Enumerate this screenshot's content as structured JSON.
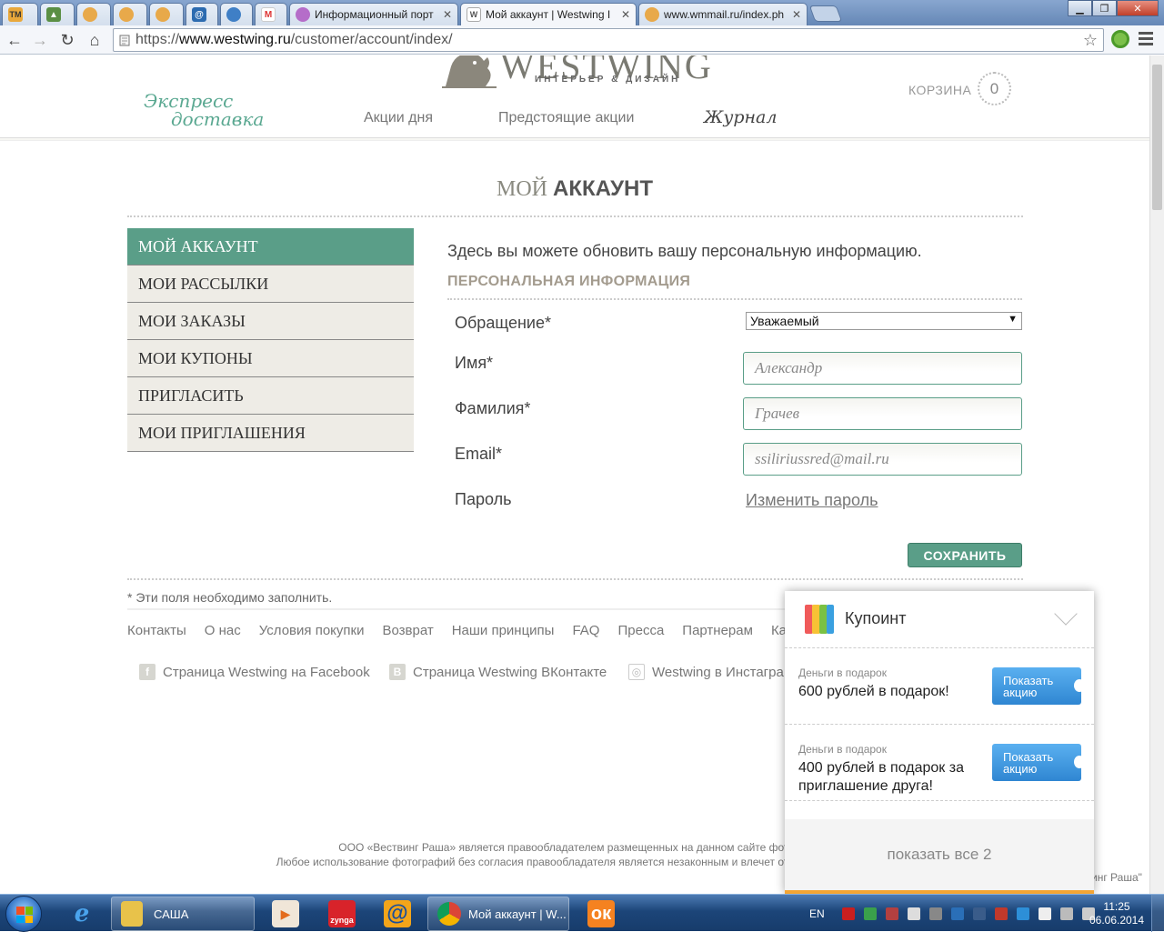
{
  "browser": {
    "tabs": [
      {
        "label": "",
        "icon": "tm-favicon"
      },
      {
        "label": "",
        "icon": "image-favicon"
      },
      {
        "label": "",
        "icon": "webmoney-favicon"
      },
      {
        "label": "",
        "icon": "webmoney-favicon"
      },
      {
        "label": "",
        "icon": "webmoney-favicon"
      },
      {
        "label": "",
        "icon": "mail-at-favicon"
      },
      {
        "label": "",
        "icon": "globe-favicon"
      },
      {
        "label": "",
        "icon": "gmail-favicon"
      },
      {
        "label": "Информационный порт",
        "icon": "portal-favicon"
      },
      {
        "label": "Мой аккаунт | Westwing I",
        "icon": "westwing-favicon"
      },
      {
        "label": "www.wmmail.ru/index.ph",
        "icon": "webmoney-favicon"
      }
    ],
    "url_prefix": "https://",
    "url_host": "www.westwing.ru",
    "url_path": "/customer/account/index/"
  },
  "header": {
    "logo_word": "WESTWING",
    "logo_sub": "ИНТЕРЬЕР & ДИЗАЙН",
    "express_line1": "Экспресс",
    "express_line2": "доставка",
    "nav": [
      "Акции дня",
      "Предстоящие акции"
    ],
    "journal": "Журнал",
    "cart_label": "КОРЗИНА",
    "cart_count": "0"
  },
  "page": {
    "title_light": "МОЙ",
    "title_bold": "АККАУНТ"
  },
  "sidebar": {
    "items": [
      {
        "label": "МОЙ АККАУНТ",
        "active": true
      },
      {
        "label": "МОИ РАССЫЛКИ",
        "active": false
      },
      {
        "label": "МОИ ЗАКАЗЫ",
        "active": false
      },
      {
        "label": "МОИ КУПОНЫ",
        "active": false
      },
      {
        "label": "ПРИГЛАСИТЬ",
        "active": false
      },
      {
        "label": "МОИ ПРИГЛАШЕНИЯ",
        "active": false
      }
    ]
  },
  "form": {
    "intro": "Здесь вы можете обновить вашу персональную информацию.",
    "section": "ПЕРСОНАЛЬНАЯ ИНФОРМАЦИЯ",
    "salutation_label": "Обращение*",
    "salutation_value": "Уважаемый",
    "first_name_label": "Имя*",
    "first_name_value": "Александр",
    "last_name_label": "Фамилия*",
    "last_name_value": "Грачев",
    "email_label": "Email*",
    "email_value": "ssiliriussred@mail.ru",
    "password_label": "Пароль",
    "change_password": "Изменить пароль",
    "save": "СОХРАНИТЬ",
    "required_note": "* Эти поля необходимо заполнить."
  },
  "footer": {
    "links": [
      "Контакты",
      "О нас",
      "Условия покупки",
      "Возврат",
      "Наши принципы",
      "FAQ",
      "Пресса",
      "Партнерам",
      "Ка"
    ],
    "facebook": "Страница Westwing на Facebook",
    "vk": "Страница Westwing ВКонтакте",
    "instagram": "Westwing в Инстагра",
    "copyright_line1": "ООО «Вествинг Раша» является правообладателем размещенных на данном сайте фотогра",
    "copyright_line2": "Любое использование фотографий без согласия правообладателя является незаконным и влечет ответственность, п",
    "copyright_tail": "инг Раша\""
  },
  "popup": {
    "title": "Купоинт",
    "offers": [
      {
        "category": "Деньги в подарок",
        "text": "600 рублей в подарок!",
        "button": "Показать акцию"
      },
      {
        "category": "Деньги в подарок",
        "text": "400 рублей в подарок за приглашение друга!",
        "button": "Показать акцию"
      }
    ],
    "show_all": "показать все 2",
    "accent": "#3a8fd9",
    "bar_color": "#f3a534"
  },
  "taskbar": {
    "folder_label": "САША",
    "chrome_label": "Мой аккаунт | W...",
    "zynga": "zynga",
    "lang": "EN",
    "time": "11:25",
    "date": "06.06.2014"
  },
  "colors": {
    "brand_green": "#5a9e88",
    "sidebar_bg": "#eeece6"
  }
}
